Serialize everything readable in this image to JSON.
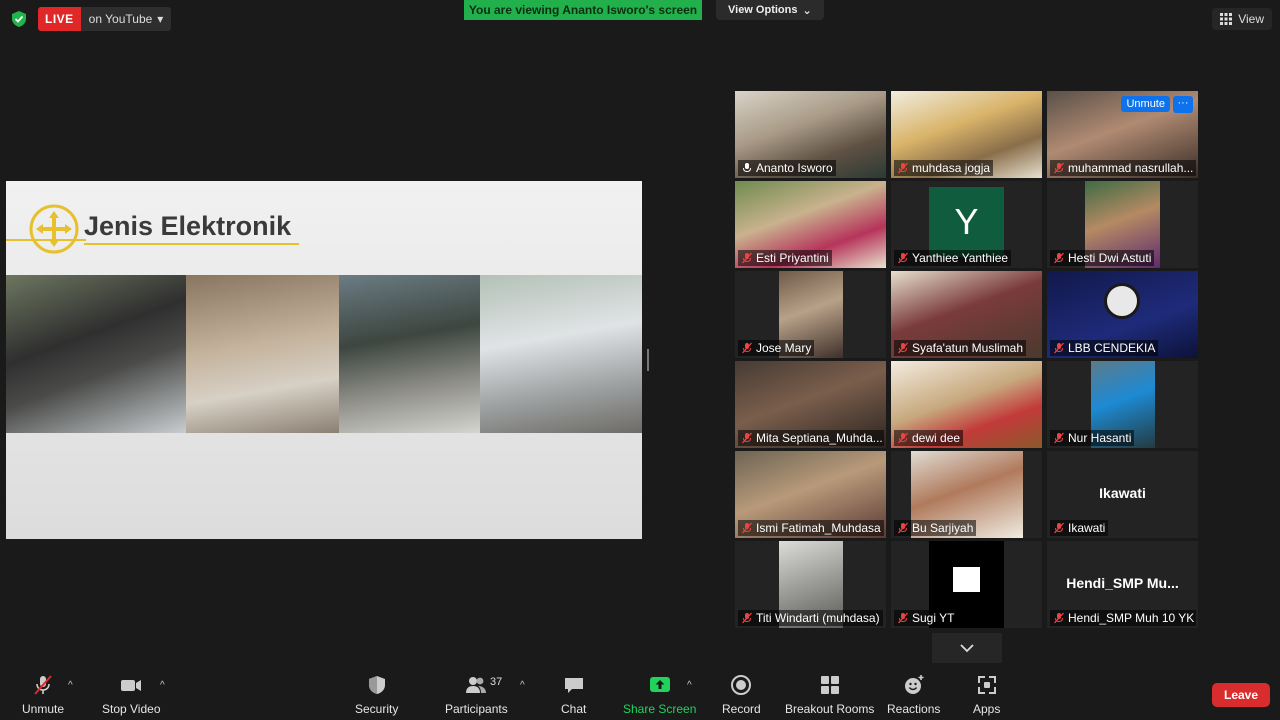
{
  "top": {
    "live_label": "LIVE",
    "live_target": "on YouTube",
    "viewing_banner": "You are viewing Ananto Isworo's screen",
    "view_options": "View Options",
    "view_button": "View"
  },
  "share": {
    "slide_title": "Jenis Elektronik"
  },
  "participants": [
    {
      "name": "Ananto Isworo"
    },
    {
      "name": "muhdasa jogja"
    },
    {
      "name": "muhammad nasrullah..."
    },
    {
      "name": "Esti Priyantini"
    },
    {
      "name": "Yanthiee Yanthiee",
      "avatar": "Y"
    },
    {
      "name": "Hesti Dwi Astuti"
    },
    {
      "name": "Jose Mary"
    },
    {
      "name": "Syafa'atun Muslimah"
    },
    {
      "name": "LBB CENDEKIA"
    },
    {
      "name": "Mita Septiana_Muhda..."
    },
    {
      "name": "dewi dee"
    },
    {
      "name": "Nur Hasanti"
    },
    {
      "name": "Ismi Fatimah_Muhdasa"
    },
    {
      "name": "Bu Sarjiyah"
    },
    {
      "name": "Ikawati",
      "center": "Ikawati"
    },
    {
      "name": "Titi Windarti (muhdasa)"
    },
    {
      "name": "Sugi YT"
    },
    {
      "name": "Hendi_SMP Muh 10 YK",
      "center": "Hendi_SMP  Mu..."
    }
  ],
  "tile_overlay": {
    "unmute": "Unmute",
    "more": "···"
  },
  "toolbar": {
    "unmute": "Unmute",
    "stop_video": "Stop Video",
    "security": "Security",
    "participants": "Participants",
    "participants_count": "37",
    "chat": "Chat",
    "share_screen": "Share Screen",
    "record": "Record",
    "breakout_rooms": "Breakout Rooms",
    "reactions": "Reactions",
    "apps": "Apps",
    "leave": "Leave"
  },
  "colors": {
    "accent_green": "#21b04b",
    "live_red": "#e02828",
    "leave_red": "#d92c2c",
    "active_speaker": "#c8e05c",
    "unmute_blue": "#0e72ed",
    "gold": "#e7c02d"
  }
}
